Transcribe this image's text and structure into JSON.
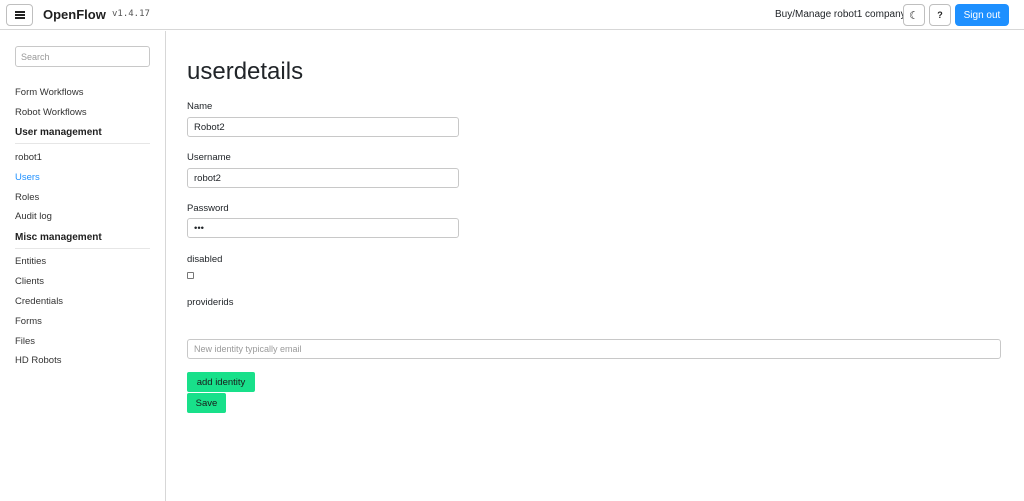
{
  "header": {
    "brand": "OpenFlow",
    "version": "v1.4.17",
    "buy_link": "Buy/Manage robot1 company",
    "moon_icon": "☾",
    "help_label": "?",
    "signout_label": "Sign out"
  },
  "sidebar": {
    "search_placeholder": "Search",
    "top_items": [
      "Form Workflows",
      "Robot Workflows"
    ],
    "user_management_header": "User management",
    "user_items": [
      "robot1",
      "Users",
      "Roles",
      "Audit log"
    ],
    "misc_management_header": "Misc management",
    "misc_items": [
      "Entities",
      "Clients",
      "Credentials",
      "Forms",
      "Files",
      "HD Robots"
    ],
    "active_item": "Users"
  },
  "form": {
    "title": "userdetails",
    "name_label": "Name",
    "name_value": "Robot2",
    "username_label": "Username",
    "username_value": "robot2",
    "password_label": "Password",
    "password_value": "•••",
    "disabled_label": "disabled",
    "disabled_checked": false,
    "providerids_label": "providerids",
    "identity_placeholder": "New identity typically email",
    "add_identity_label": "add identity",
    "save_label": "Save"
  },
  "colors": {
    "accent_blue": "#1e90ff",
    "button_green": "#18e08a"
  }
}
